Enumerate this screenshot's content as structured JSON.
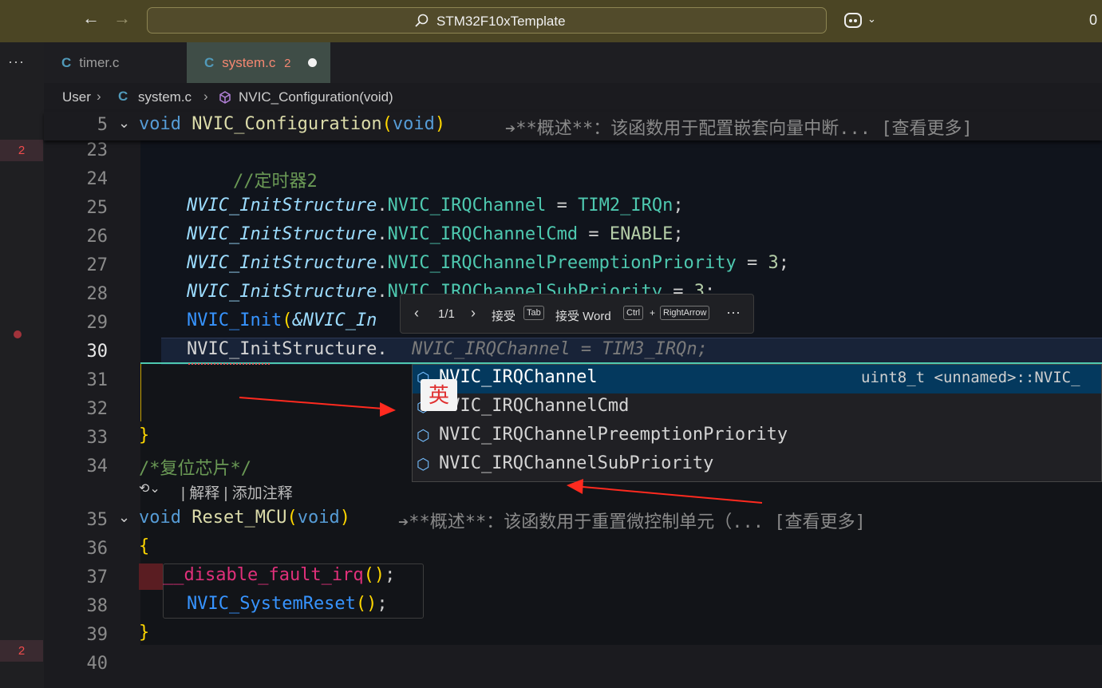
{
  "title_bar": {
    "search_text": "STM32F10xTemplate",
    "back_icon": "←",
    "forward_icon": "→",
    "right_edge": "0"
  },
  "activity": {
    "more": "···",
    "badge_top": "2",
    "badge_bottom": "2"
  },
  "tabs": [
    {
      "label": "timer.c",
      "icon": "C"
    },
    {
      "label": "system.c",
      "icon": "C",
      "problems": "2"
    }
  ],
  "breadcrumb": {
    "folder": "User",
    "file": "system.c",
    "symbol": "NVIC_Configuration(void)"
  },
  "sticky": {
    "line": "5",
    "kw": "void",
    "name": "NVIC_Configuration",
    "param": "void",
    "summary": "➔**概述**：该函数用于配置嵌套向量中断... [查看更多]"
  },
  "lines": {
    "l23": "23",
    "l24": "24",
    "l25": "25",
    "l26": "26",
    "l27": "27",
    "l28": "28",
    "l29": "29",
    "l30": "30",
    "l31": "31",
    "l32": "32",
    "l33": "33",
    "l34": "34",
    "l35": "35",
    "l36": "36",
    "l37": "37",
    "l38": "38",
    "l39": "39",
    "l40": "40"
  },
  "code": {
    "comment_timer": "//定时器2",
    "struct": "NVIC_InitStructure",
    "m1": "NVIC_IRQChannel",
    "v1": "TIM2_IRQn",
    "m2": "NVIC_IRQChannelCmd",
    "v2": "ENABLE",
    "m3": "NVIC_IRQChannelPreemptionPriority",
    "v3": "3",
    "m4": "NVIC_IRQChannelSubPriority",
    "v4": "3",
    "init_fn": "NVIC_Init",
    "init_arg": "&NVIC_In",
    "ghost": "NVIC_IRQChannel = TIM3_IRQn;",
    "close_brace": "}",
    "comment_reset": "/*复位芯片*/",
    "codelens": "| 解释 | 添加注释",
    "reset_kw": "void",
    "reset_name": "Reset_MCU",
    "reset_param": "void",
    "reset_summary": "➔**概述**：该函数用于重置微控制单元（... [查看更多]",
    "open_brace": "{",
    "disable_fn": "__disable_fault_irq",
    "sysreset_fn": "NVIC_SystemReset"
  },
  "inline_toolbar": {
    "counter": "1/1",
    "accept": "接受",
    "accept_key": "Tab",
    "accept_word": "接受 Word",
    "ctrl_key": "Ctrl",
    "plus": "+",
    "arrow_key": "RightArrow",
    "more": "···"
  },
  "suggestions": {
    "items": [
      "NVIC_IRQChannel",
      "NVIC_IRQChannelCmd",
      "NVIC_IRQChannelPreemptionPriority",
      "NVIC_IRQChannelSubPriority"
    ],
    "detail": "uint8_t <unnamed>::NVIC_"
  },
  "ime": {
    "label": "英"
  }
}
